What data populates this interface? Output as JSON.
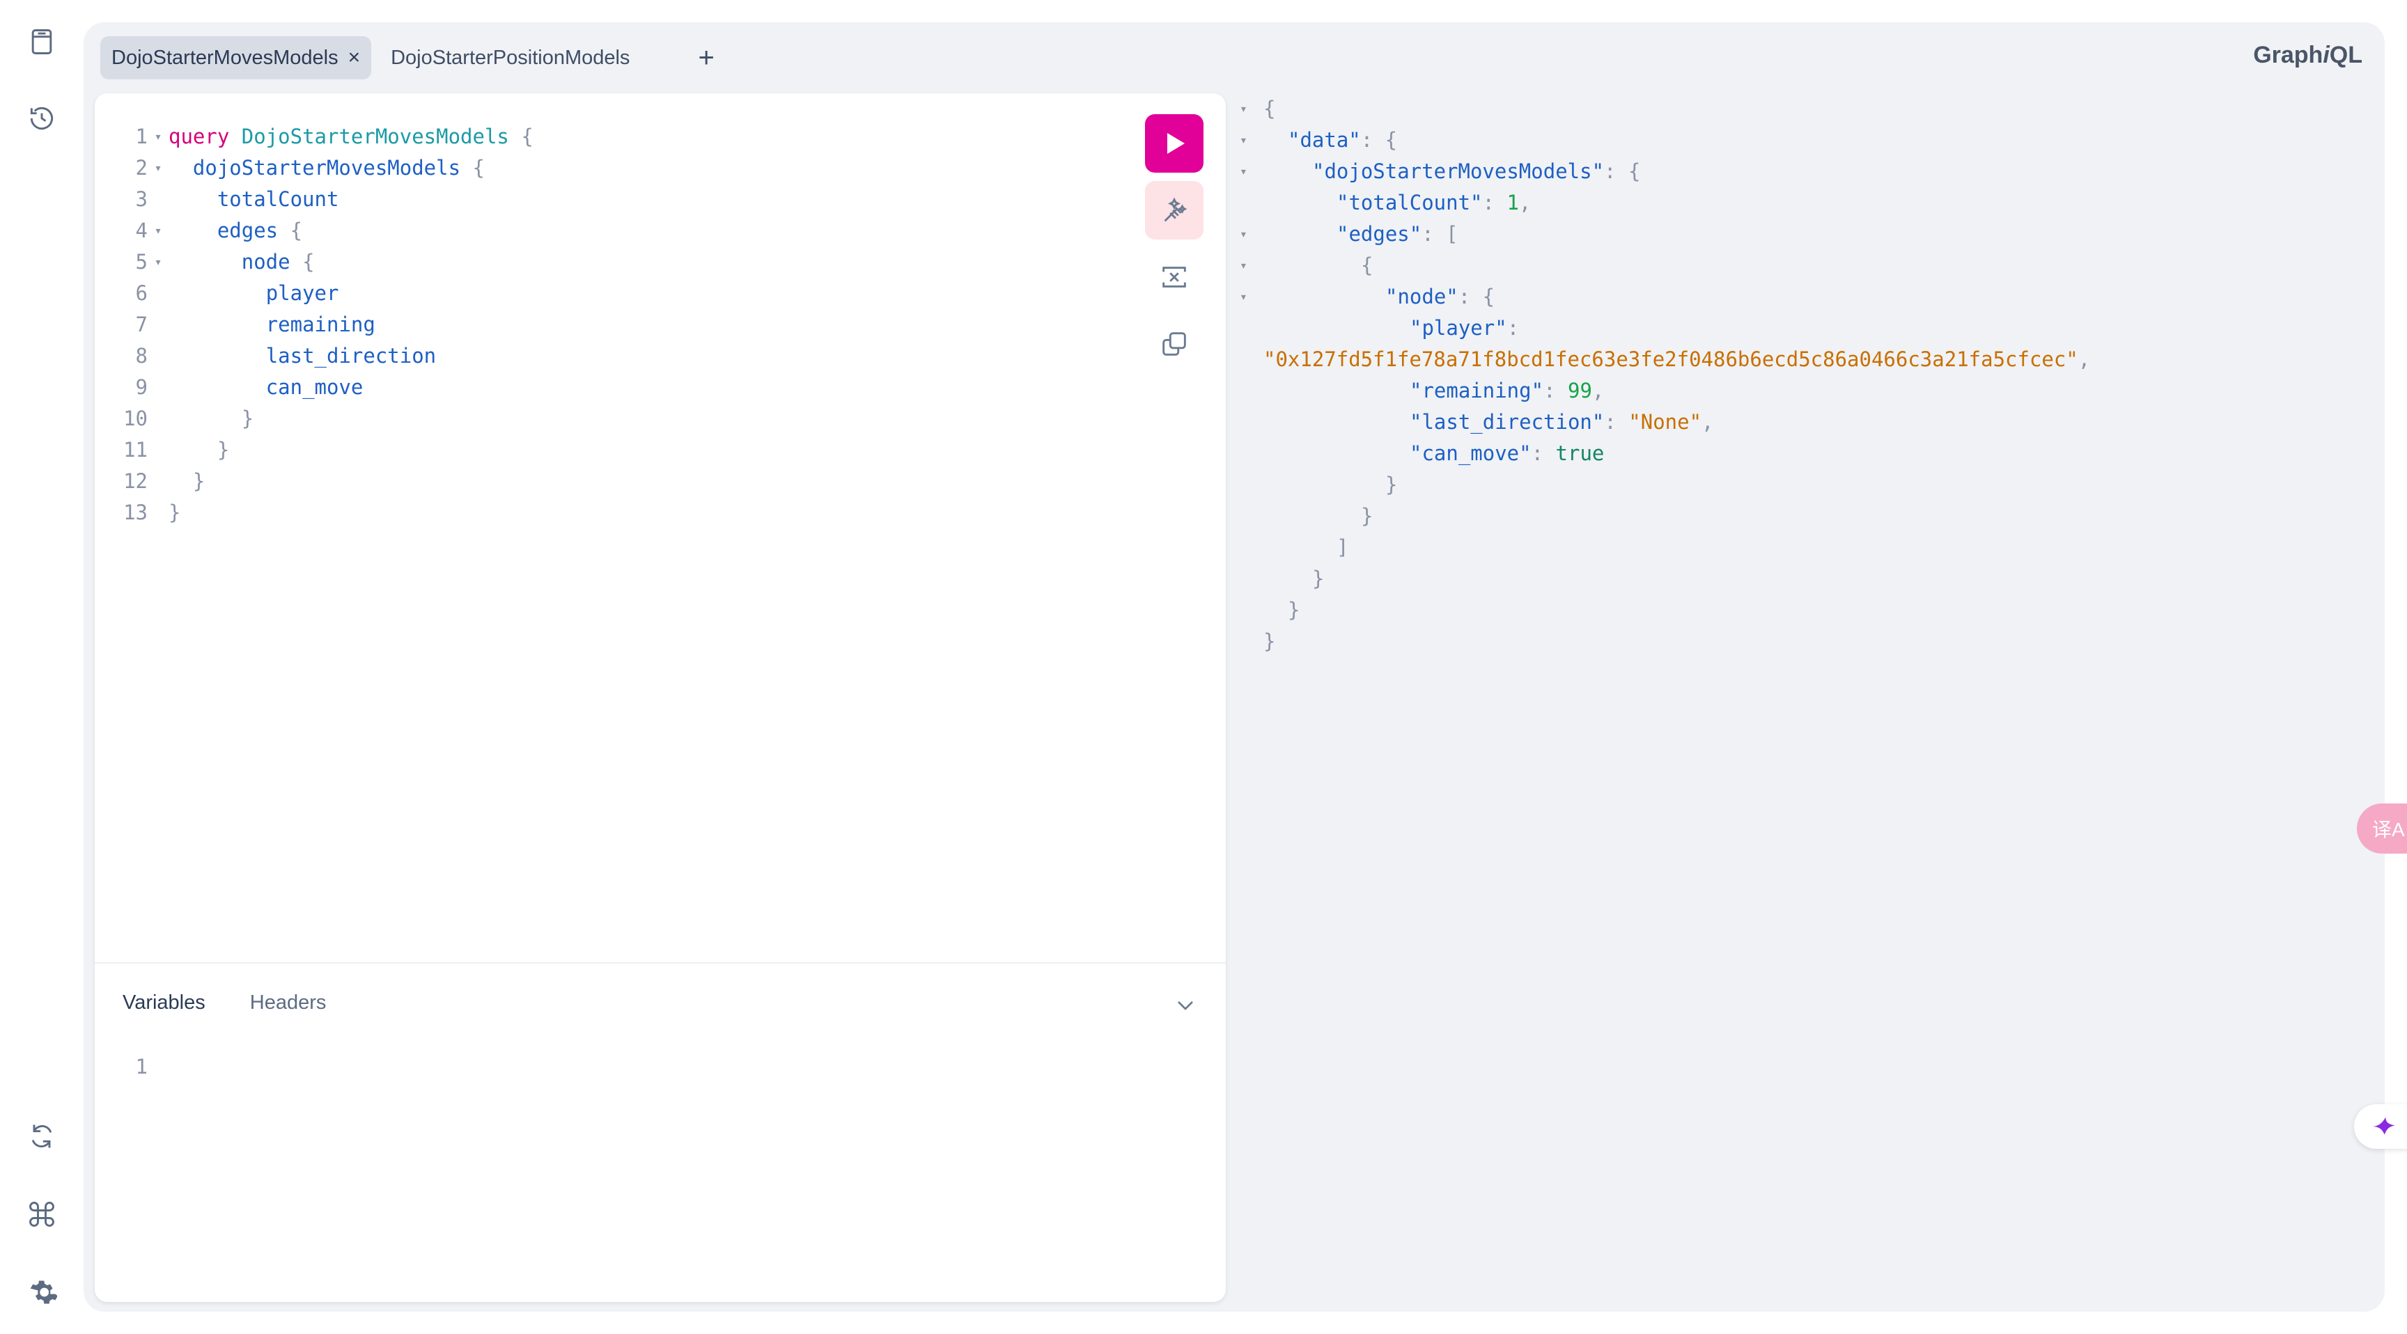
{
  "tabs": [
    {
      "label": "DojoStarterMovesModels",
      "active": true,
      "close": "×"
    },
    {
      "label": "DojoStarterPositionModels",
      "active": false
    }
  ],
  "tab_add": "+",
  "brand": {
    "prefix": "Graph",
    "italic": "i",
    "suffix": "QL"
  },
  "editor": {
    "lines": [
      {
        "n": "1",
        "fold": "▾",
        "parts": [
          [
            "kw",
            "query "
          ],
          [
            "def",
            "DojoStarterMovesModels"
          ],
          [
            "punc",
            " {"
          ]
        ]
      },
      {
        "n": "2",
        "fold": "▾",
        "parts": [
          [
            "plain",
            "  "
          ],
          [
            "fld",
            "dojoStarterMovesModels"
          ],
          [
            "punc",
            " {"
          ]
        ]
      },
      {
        "n": "3",
        "fold": "",
        "parts": [
          [
            "plain",
            "    "
          ],
          [
            "fld",
            "totalCount"
          ]
        ]
      },
      {
        "n": "4",
        "fold": "▾",
        "parts": [
          [
            "plain",
            "    "
          ],
          [
            "fld",
            "edges"
          ],
          [
            "punc",
            " {"
          ]
        ]
      },
      {
        "n": "5",
        "fold": "▾",
        "parts": [
          [
            "plain",
            "      "
          ],
          [
            "fld",
            "node"
          ],
          [
            "punc",
            " {"
          ]
        ]
      },
      {
        "n": "6",
        "fold": "",
        "parts": [
          [
            "plain",
            "        "
          ],
          [
            "fld",
            "player"
          ]
        ]
      },
      {
        "n": "7",
        "fold": "",
        "parts": [
          [
            "plain",
            "        "
          ],
          [
            "fld",
            "remaining"
          ]
        ]
      },
      {
        "n": "8",
        "fold": "",
        "parts": [
          [
            "plain",
            "        "
          ],
          [
            "fld",
            "last_direction"
          ]
        ]
      },
      {
        "n": "9",
        "fold": "",
        "parts": [
          [
            "plain",
            "        "
          ],
          [
            "fld",
            "can_move"
          ]
        ]
      },
      {
        "n": "10",
        "fold": "",
        "parts": [
          [
            "plain",
            "      "
          ],
          [
            "punc",
            "}"
          ]
        ]
      },
      {
        "n": "11",
        "fold": "",
        "parts": [
          [
            "plain",
            "    "
          ],
          [
            "punc",
            "}"
          ]
        ]
      },
      {
        "n": "12",
        "fold": "",
        "parts": [
          [
            "plain",
            "  "
          ],
          [
            "punc",
            "}"
          ]
        ]
      },
      {
        "n": "13",
        "fold": "",
        "parts": [
          [
            "punc",
            "}"
          ]
        ]
      }
    ]
  },
  "variables": {
    "tabs": [
      {
        "label": "Variables",
        "active": true
      },
      {
        "label": "Headers",
        "active": false
      }
    ],
    "lines": [
      "1"
    ]
  },
  "result": {
    "lines": [
      {
        "fold": "▾",
        "indent": 0,
        "parts": [
          [
            "punc",
            "{"
          ]
        ]
      },
      {
        "fold": "▾",
        "indent": 1,
        "parts": [
          [
            "key",
            "\"data\""
          ],
          [
            "punc",
            ": {"
          ]
        ]
      },
      {
        "fold": "▾",
        "indent": 2,
        "parts": [
          [
            "key",
            "\"dojoStarterMovesModels\""
          ],
          [
            "punc",
            ": {"
          ]
        ]
      },
      {
        "fold": "",
        "indent": 3,
        "parts": [
          [
            "key",
            "\"totalCount\""
          ],
          [
            "punc",
            ": "
          ],
          [
            "num",
            "1"
          ],
          [
            "punc",
            ","
          ]
        ]
      },
      {
        "fold": "▾",
        "indent": 3,
        "parts": [
          [
            "key",
            "\"edges\""
          ],
          [
            "punc",
            ": ["
          ]
        ]
      },
      {
        "fold": "▾",
        "indent": 4,
        "parts": [
          [
            "punc",
            "{"
          ]
        ]
      },
      {
        "fold": "▾",
        "indent": 5,
        "parts": [
          [
            "key",
            "\"node\""
          ],
          [
            "punc",
            ": {"
          ]
        ]
      },
      {
        "fold": "",
        "indent": 6,
        "parts": [
          [
            "key",
            "\"player\""
          ],
          [
            "punc",
            ":"
          ]
        ]
      },
      {
        "fold": "",
        "indent": 0,
        "parts": [
          [
            "str",
            "\"0x127fd5f1fe78a71f8bcd1fec63e3fe2f0486b6ecd5c86a0466c3a21fa5cfcec\""
          ],
          [
            "punc",
            ","
          ]
        ]
      },
      {
        "fold": "",
        "indent": 6,
        "parts": [
          [
            "key",
            "\"remaining\""
          ],
          [
            "punc",
            ": "
          ],
          [
            "num",
            "99"
          ],
          [
            "punc",
            ","
          ]
        ]
      },
      {
        "fold": "",
        "indent": 6,
        "parts": [
          [
            "key",
            "\"last_direction\""
          ],
          [
            "punc",
            ": "
          ],
          [
            "str",
            "\"None\""
          ],
          [
            "punc",
            ","
          ]
        ]
      },
      {
        "fold": "",
        "indent": 6,
        "parts": [
          [
            "key",
            "\"can_move\""
          ],
          [
            "punc",
            ": "
          ],
          [
            "bool",
            "true"
          ]
        ]
      },
      {
        "fold": "",
        "indent": 5,
        "parts": [
          [
            "punc",
            "}"
          ]
        ]
      },
      {
        "fold": "",
        "indent": 4,
        "parts": [
          [
            "punc",
            "}"
          ]
        ]
      },
      {
        "fold": "",
        "indent": 3,
        "parts": [
          [
            "punc",
            "]"
          ]
        ]
      },
      {
        "fold": "",
        "indent": 2,
        "parts": [
          [
            "punc",
            "}"
          ]
        ]
      },
      {
        "fold": "",
        "indent": 1,
        "parts": [
          [
            "punc",
            "}"
          ]
        ]
      },
      {
        "fold": "",
        "indent": 0,
        "parts": [
          [
            "punc",
            "}"
          ]
        ]
      }
    ]
  },
  "floating": {
    "translate_label": "译A"
  },
  "icons": {
    "sidebar_top": [
      "docs-icon",
      "history-icon"
    ],
    "sidebar_bottom": [
      "refetch-schema-icon",
      "shortcuts-icon",
      "settings-icon"
    ],
    "toolbar": [
      "run-icon",
      "prettify-icon",
      "merge-fragments-icon",
      "copy-icon"
    ]
  },
  "colors": {
    "accent": "#e10098",
    "keyword": "#d6007c",
    "field": "#1e5fc4",
    "string": "#c96f00",
    "number": "#16a34a"
  }
}
